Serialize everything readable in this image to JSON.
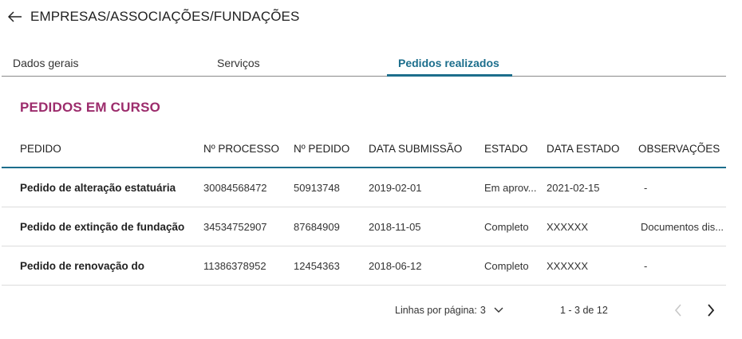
{
  "header": {
    "title": "EMPRESAS/ASSOCIAÇÕES/FUNDAÇÕES",
    "back_icon": "arrow-left-icon"
  },
  "tabs": [
    {
      "label": "Dados gerais",
      "active": false
    },
    {
      "label": "Serviços",
      "active": false
    },
    {
      "label": "Pedidos realizados",
      "active": true
    }
  ],
  "section": {
    "title": "PEDIDOS EM CURSO"
  },
  "table": {
    "columns": [
      "PEDIDO",
      "Nº PROCESSO",
      "Nº PEDIDO",
      "DATA SUBMISSÃO",
      "ESTADO",
      "DATA ESTADO",
      "OBSERVAÇÕES"
    ],
    "rows": [
      {
        "pedido": "Pedido de alteração estatuária",
        "processo": "30084568472",
        "num_pedido": "50913748",
        "data_submissao": "2019-02-01",
        "estado": "Em aprov...",
        "data_estado": "2021-02-15",
        "observacoes": "-"
      },
      {
        "pedido": "Pedido de extinção de fundação",
        "processo": "34534752907",
        "num_pedido": "87684909",
        "data_submissao": "2018-11-05",
        "estado": "Completo",
        "data_estado": "XXXXXX",
        "observacoes": "Documentos dis..."
      },
      {
        "pedido": "Pedido de renovação do",
        "processo": "11386378952",
        "num_pedido": "12454363",
        "data_submissao": "2018-06-12",
        "estado": "Completo",
        "data_estado": "XXXXXX",
        "observacoes": "-"
      }
    ]
  },
  "pagination": {
    "rows_per_page_label": "Linhas por página:",
    "rows_per_page_value": "3",
    "range": "1 - 3 de 12"
  },
  "colors": {
    "accent": "#1c6e8c",
    "section_title": "#9c2c6c",
    "divider": "#dcdcdc"
  }
}
